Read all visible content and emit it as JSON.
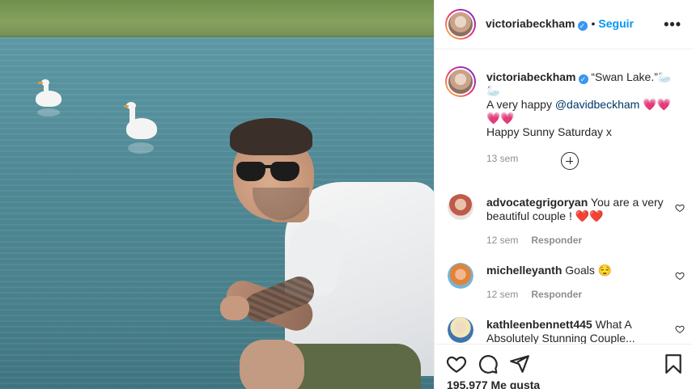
{
  "post": {
    "author": "victoriabeckham",
    "follow_label": "Seguir",
    "dot": "•",
    "more_label": "•••",
    "caption_line1": "“Swan Lake.”🦢🦢",
    "caption_line2_prefix": "A very happy ",
    "caption_mention": "@davidbeckham",
    "caption_line2_suffix": " 💗💗💗💗",
    "caption_line3": "Happy Sunny Saturday x",
    "time": "13 sem"
  },
  "comments": [
    {
      "username": "advocategrigoryan",
      "text": "You are a very beautiful couple ! ❤️❤️",
      "time": "12 sem",
      "reply_label": "Responder"
    },
    {
      "username": "michelleyanth",
      "text": "Goals 😌",
      "time": "12 sem",
      "reply_label": "Responder"
    },
    {
      "username": "kathleenbennett445",
      "text": "What A Absolutely Stunning Couple...",
      "time": "",
      "reply_label": ""
    }
  ],
  "footer": {
    "likes": "195.977 Me gusta"
  },
  "icons": {
    "verified": "verified-badge-icon",
    "more": "more-options-icon",
    "load_more": "plus-circle-icon",
    "like": "heart-icon",
    "comment": "comment-bubble-icon",
    "share": "paper-plane-icon",
    "save": "bookmark-icon"
  },
  "colors": {
    "link_blue": "#0095f6",
    "mention": "#00376b",
    "verified": "#3897f0",
    "muted_text": "#8e8e8e",
    "text": "#262626"
  }
}
